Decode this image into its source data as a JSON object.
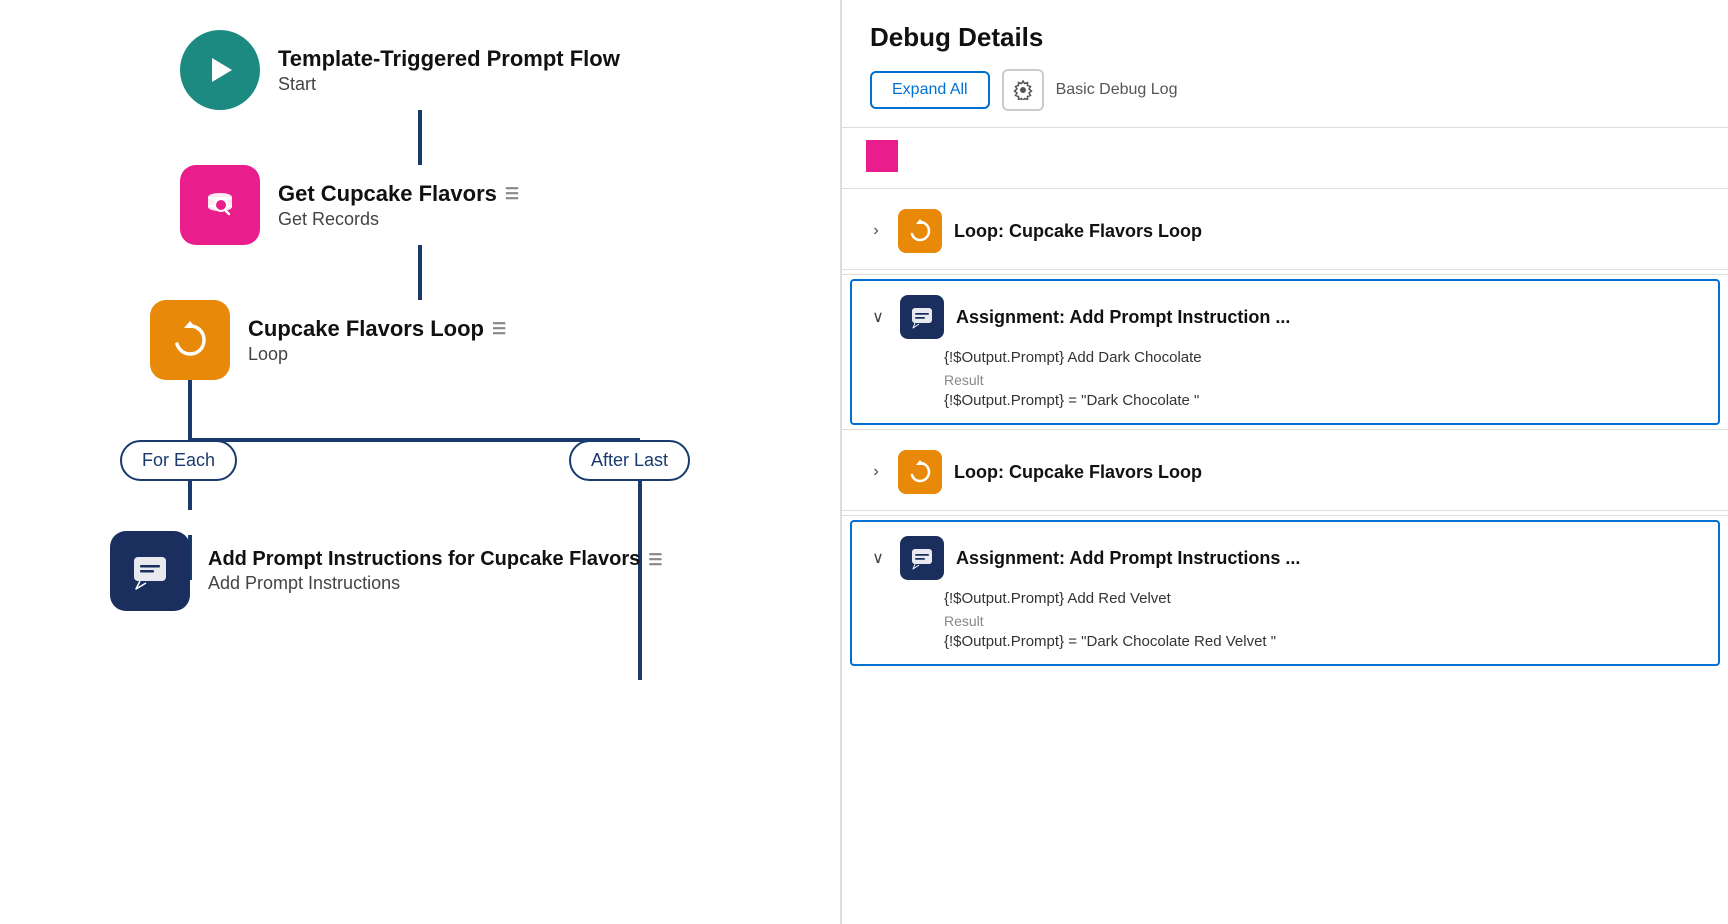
{
  "flow": {
    "nodes": [
      {
        "id": "start",
        "title": "Template-Triggered Prompt Flow",
        "subtitle": "Start",
        "icon_type": "teal",
        "icon_symbol": "play",
        "has_menu": false
      },
      {
        "id": "get-cupcake",
        "title": "Get Cupcake Flavors",
        "subtitle": "Get Records",
        "icon_type": "pink",
        "icon_symbol": "search-db",
        "has_menu": true
      },
      {
        "id": "cupcake-loop",
        "title": "Cupcake Flavors Loop",
        "subtitle": "Loop",
        "icon_type": "orange",
        "icon_symbol": "refresh",
        "has_menu": true
      }
    ],
    "loop": {
      "branch_for_each": "For Each",
      "branch_after_last": "After Last",
      "child_node": {
        "title": "Add Prompt Instructions for Cupcake Flavors",
        "subtitle": "Add Prompt Instructions",
        "icon_type": "dark-blue",
        "icon_symbol": "chat",
        "has_menu": true
      }
    }
  },
  "debug": {
    "title": "Debug Details",
    "toolbar": {
      "expand_all": "Expand All",
      "gear_label": "Settings",
      "log_label": "Basic Debug Log"
    },
    "items": [
      {
        "id": "loop1",
        "type": "loop",
        "icon_type": "orange",
        "chevron": "›",
        "title": "Loop: Cupcake Flavors Loop",
        "selected": false
      },
      {
        "id": "assignment1",
        "type": "assignment",
        "icon_type": "dark-blue",
        "chevron": "∨",
        "title": "Assignment: Add Prompt Instruction ...",
        "selected": true,
        "formula": "{!$Output.Prompt} Add Dark Chocolate",
        "result_label": "Result",
        "result_value": "{!$Output.Prompt} = \"Dark Chocolate \""
      },
      {
        "id": "loop2",
        "type": "loop",
        "icon_type": "orange",
        "chevron": "›",
        "title": "Loop: Cupcake Flavors Loop",
        "selected": false
      },
      {
        "id": "assignment2",
        "type": "assignment",
        "icon_type": "dark-blue",
        "chevron": "∨",
        "title": "Assignment: Add Prompt Instructions ...",
        "selected": true,
        "formula": "{!$Output.Prompt} Add Red Velvet",
        "result_label": "Result",
        "result_value": "{!$Output.Prompt} = \"Dark Chocolate Red Velvet \""
      }
    ]
  }
}
